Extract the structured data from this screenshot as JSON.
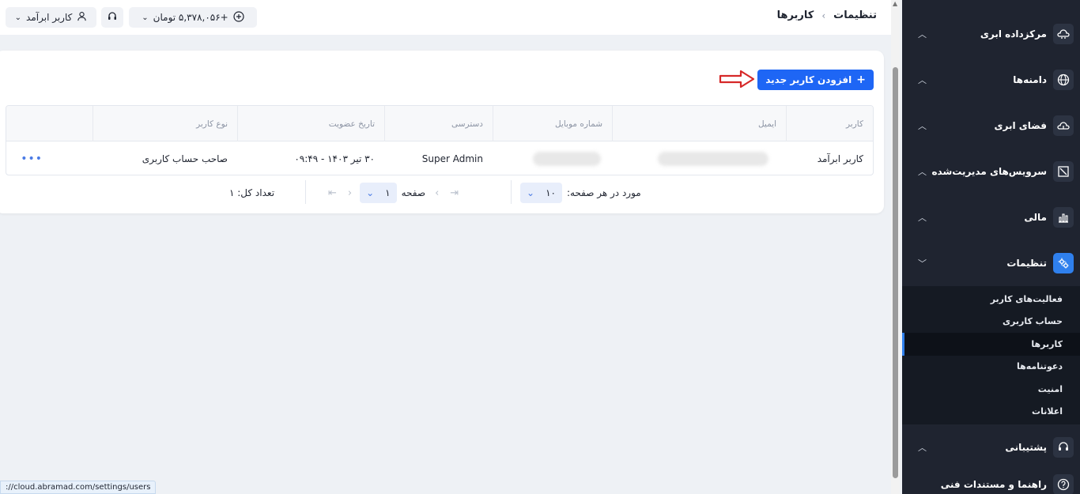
{
  "topbar": {
    "breadcrumb_root": "تنظیمات",
    "breadcrumb_sep": "›",
    "breadcrumb_current": "کاربرها",
    "balance": "+۵,۳۷۸,۰۵۶ تومان",
    "user_menu": "کاربر ابرآمد"
  },
  "sidebar": {
    "items": [
      {
        "label": "مرکزداده ابری",
        "icon": "cloud-server-icon"
      },
      {
        "label": "دامنه‌ها",
        "icon": "globe-icon"
      },
      {
        "label": "فضای ابری",
        "icon": "cloud-space-icon"
      },
      {
        "label": "سرویس‌های مدیریت‌شده",
        "icon": "managed-services-icon"
      },
      {
        "label": "مالی",
        "icon": "chart-icon"
      },
      {
        "label": "تنظیمات",
        "icon": "settings-icon"
      }
    ],
    "sub_items": [
      "فعالیت‌های کاربر",
      "حساب کاربری",
      "کاربرها",
      "دعوتنامه‌ها",
      "امنیت",
      "اعلانات"
    ],
    "active_sub": "کاربرها",
    "bottom_items": [
      {
        "label": "پشتیبانی",
        "icon": "headset-icon"
      },
      {
        "label": "راهنما و مستندات فنی",
        "icon": "help-icon"
      }
    ]
  },
  "main": {
    "add_button": "افزودن کاربر جدید",
    "table": {
      "headers": [
        "کاربر",
        "ایمیل",
        "شماره موبایل",
        "دسترسی",
        "تاریخ عضویت",
        "نوع کاربر"
      ],
      "rows": [
        {
          "user": "کاربر ابرآمد",
          "access": "Super Admin",
          "joined": "۳۰ تیر ۱۴۰۳ - ۰۹:۴۹",
          "type": "صاحب حساب کاربری",
          "actions": "•••"
        }
      ]
    },
    "pager": {
      "per_page_label": "مورد در هر صفحه:",
      "per_page_value": "۱۰",
      "page_label": "صفحه",
      "page_value": "۱",
      "total_label": "تعداد کل: ۱"
    }
  },
  "status_bar": "://cloud.abramad.com/settings/users",
  "colors": {
    "accent": "#1e66f5",
    "sidebar": "#1f2430",
    "arrow": "#d62828"
  }
}
